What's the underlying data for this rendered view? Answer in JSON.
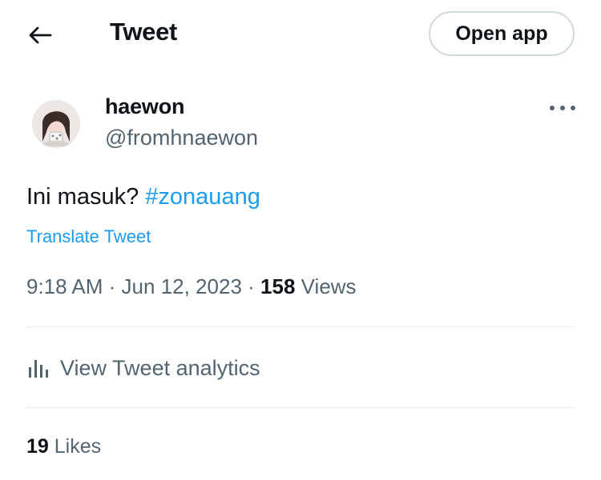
{
  "header": {
    "back_icon": "arrow-left-icon",
    "title": "Tweet",
    "open_app_label": "Open app"
  },
  "author": {
    "display_name": "haewon",
    "handle": "@fromhnaewon",
    "more_icon": "more-horizontal-icon"
  },
  "tweet": {
    "text": "Ini masuk?",
    "hashtag": "#zonauang",
    "translate_label": "Translate Tweet"
  },
  "meta": {
    "time": "9:18 AM",
    "separator": "·",
    "date": "Jun 12, 2023",
    "views_count": "158",
    "views_label": "Views"
  },
  "analytics": {
    "icon": "bar-chart-icon",
    "label": "View Tweet analytics"
  },
  "engagement": {
    "likes_count": "19",
    "likes_label": "Likes"
  },
  "colors": {
    "text_primary": "#0f1419",
    "text_secondary": "#536471",
    "accent": "#1d9bf0",
    "border": "#cfd9de"
  }
}
